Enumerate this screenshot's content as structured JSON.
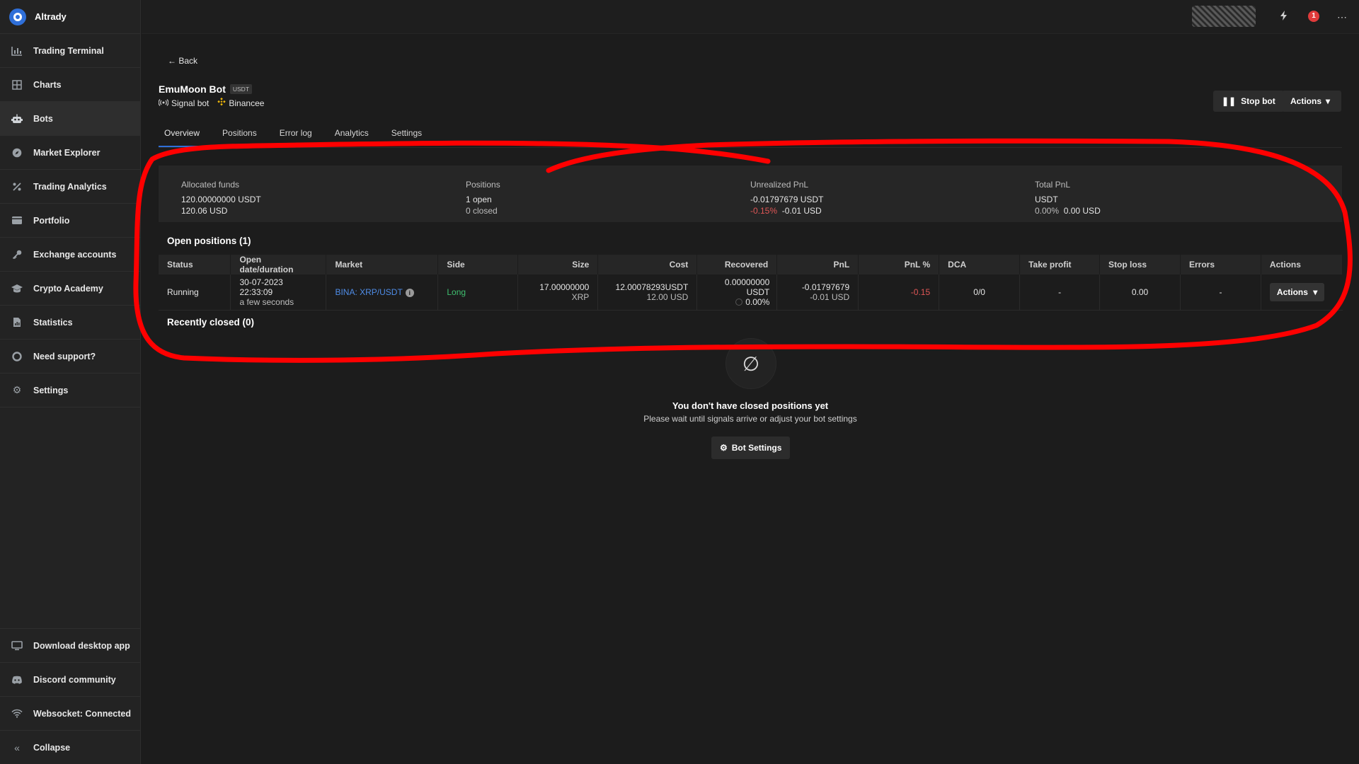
{
  "app": {
    "name": "Altrady"
  },
  "sidebar": {
    "items": [
      {
        "label": "Trading Terminal",
        "icon": "chart-icon"
      },
      {
        "label": "Charts",
        "icon": "grid-icon"
      },
      {
        "label": "Bots",
        "icon": "robot-icon"
      },
      {
        "label": "Market Explorer",
        "icon": "compass-icon"
      },
      {
        "label": "Trading Analytics",
        "icon": "percent-icon"
      },
      {
        "label": "Portfolio",
        "icon": "wallet-icon"
      },
      {
        "label": "Exchange accounts",
        "icon": "key-icon"
      },
      {
        "label": "Crypto Academy",
        "icon": "graduation-icon"
      },
      {
        "label": "Statistics",
        "icon": "report-icon"
      },
      {
        "label": "Need support?",
        "icon": "lifebuoy-icon"
      },
      {
        "label": "Settings",
        "icon": "gear-icon"
      }
    ],
    "bottom": [
      {
        "label": "Download desktop app",
        "icon": "monitor-icon"
      },
      {
        "label": "Discord community",
        "icon": "discord-icon"
      },
      {
        "label": "Websocket: Connected",
        "icon": "wifi-icon"
      },
      {
        "label": "Collapse",
        "icon": "double-chevron-left-icon"
      }
    ]
  },
  "topbar": {
    "notifications": "1"
  },
  "bot": {
    "back": "Back",
    "name": "EmuMoon Bot",
    "quote": "USDT",
    "type": "Signal bot",
    "exchange": "Binancee",
    "stop_label": "Stop bot",
    "actions_label": "Actions"
  },
  "tabs": [
    "Overview",
    "Positions",
    "Error log",
    "Analytics",
    "Settings"
  ],
  "summary": {
    "allocated": {
      "label": "Allocated funds",
      "line1": "120.00000000 USDT",
      "line2": "120.06 USD"
    },
    "positions": {
      "label": "Positions",
      "line1": "1 open",
      "line2": "0 closed"
    },
    "unrealized": {
      "label": "Unrealized PnL",
      "line1": "-0.01797679 USDT",
      "pct": "-0.15%",
      "usd": "-0.01 USD"
    },
    "total": {
      "label": "Total PnL",
      "line1": "USDT",
      "pct": "0.00%",
      "usd": "0.00 USD"
    }
  },
  "open_positions": {
    "title": "Open positions (1)",
    "columns": [
      "Status",
      "Open date/duration",
      "Market",
      "Side",
      "Size",
      "Cost",
      "Recovered",
      "PnL",
      "PnL %",
      "DCA",
      "Take profit",
      "Stop loss",
      "Errors",
      "Actions"
    ],
    "rows": [
      {
        "status": "Running",
        "date": "30-07-2023 22:33:09",
        "duration": "a few seconds",
        "market": "BINA: XRP/USDT",
        "side": "Long",
        "size": "17.00000000",
        "size_unit": "XRP",
        "cost": "12.00078293USDT",
        "cost_usd": "12.00 USD",
        "recovered": "0.00000000 USDT",
        "recovered_pct": "0.00%",
        "pnl": "-0.01797679",
        "pnl_usd": "-0.01 USD",
        "pnl_pct": "-0.15",
        "dca": "0/0",
        "take_profit": "-",
        "stop_loss": "0.00",
        "errors": "-",
        "action": "Actions"
      }
    ]
  },
  "recently_closed": {
    "title": "Recently closed (0)",
    "empty_title": "You don't have closed positions yet",
    "empty_sub": "Please wait until signals arrive or adjust your bot settings",
    "button": "Bot Settings"
  },
  "colors": {
    "accent": "#2f6fd8",
    "negative": "#e05656",
    "positive": "#3fbf6f",
    "annotation": "#ff0000"
  }
}
